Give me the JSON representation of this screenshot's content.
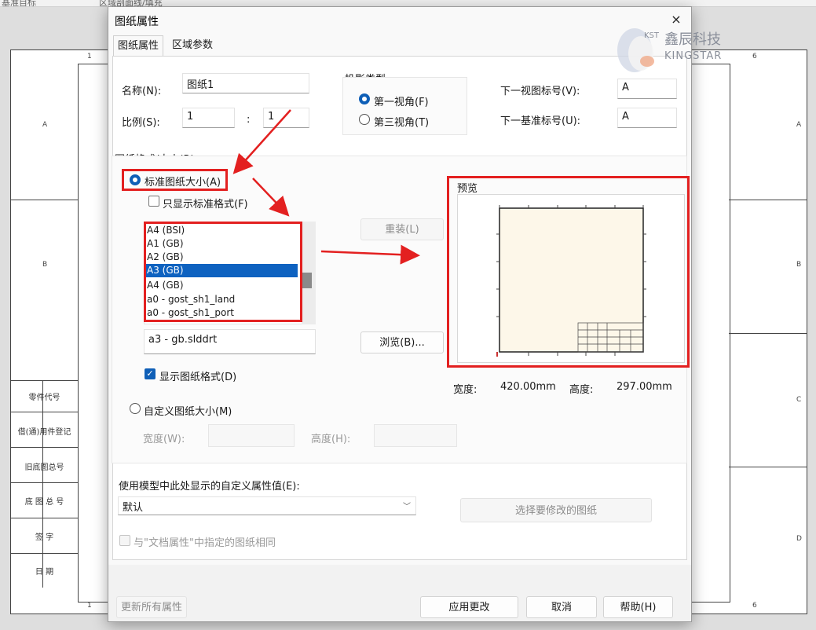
{
  "background": {
    "toolbar_items": [
      "基准目标",
      "区域剖面线/填充"
    ],
    "zones_top": [
      "1",
      "6"
    ],
    "zones_left": [
      "A",
      "B"
    ],
    "zones_right": [
      "A",
      "B",
      "C",
      "D"
    ],
    "title_block_labels": [
      "零件代号",
      "借(通)用件登记",
      "旧底图总号",
      "底 图 总 号",
      "签  字",
      "日  期"
    ]
  },
  "logo": {
    "cn": "鑫辰科技",
    "en": "KINGSTAR",
    "abbr": "KST"
  },
  "dialog": {
    "title": "图纸属性",
    "close_symbol": "×",
    "tabs": [
      {
        "label": "图纸属性",
        "active": true
      },
      {
        "label": "区域参数",
        "active": false
      }
    ],
    "name_label": "名称(N):",
    "name_value": "图纸1",
    "scale_label": "比例(S):",
    "scale_num": "1",
    "scale_sep": ":",
    "scale_den": "1",
    "projection": {
      "group_label": "投影类型",
      "first_angle": "第一视角(F)",
      "third_angle": "第三视角(T)",
      "selected": "first"
    },
    "next_view_label": "下一视图标号(V):",
    "next_view_value": "A",
    "next_datum_label": "下一基准标号(U):",
    "next_datum_value": "A",
    "format_group_label": "图纸格式/大小(R)",
    "standard_size_label": "标准图纸大小(A)",
    "only_standard_label": "只显示标准格式(F)",
    "paper_list": [
      "A4 (BSI)",
      "A1 (GB)",
      "A2 (GB)",
      "A3 (GB)",
      "A4 (GB)",
      "a0 - gost_sh1_land",
      "a0 - gost_sh1_port"
    ],
    "paper_selected": "A3 (GB)",
    "reload_button": "重装(L)",
    "format_file": "a3 - gb.slddrt",
    "browse_button": "浏览(B)...",
    "show_format_label": "显示图纸格式(D)",
    "preview_label": "预览",
    "width_label": "宽度:",
    "width_value": "420.00mm",
    "height_label": "高度:",
    "height_value": "297.00mm",
    "custom_size_label": "自定义图纸大小(M)",
    "custom_width_label": "宽度(W):",
    "custom_height_label": "高度(H):",
    "custom_props_label": "使用模型中此处显示的自定义属性值(E):",
    "custom_props_value": "默认",
    "select_sheets_button": "选择要修改的图纸",
    "same_as_doc_label": "与\"文档属性\"中指定的图纸相同",
    "update_all_button": "更新所有属性",
    "apply_button": "应用更改",
    "cancel_button": "取消",
    "help_button": "帮助(H)"
  },
  "colors": {
    "accent": "#0f5fb7",
    "highlight": "#e32020",
    "selection": "#0e62c0"
  }
}
